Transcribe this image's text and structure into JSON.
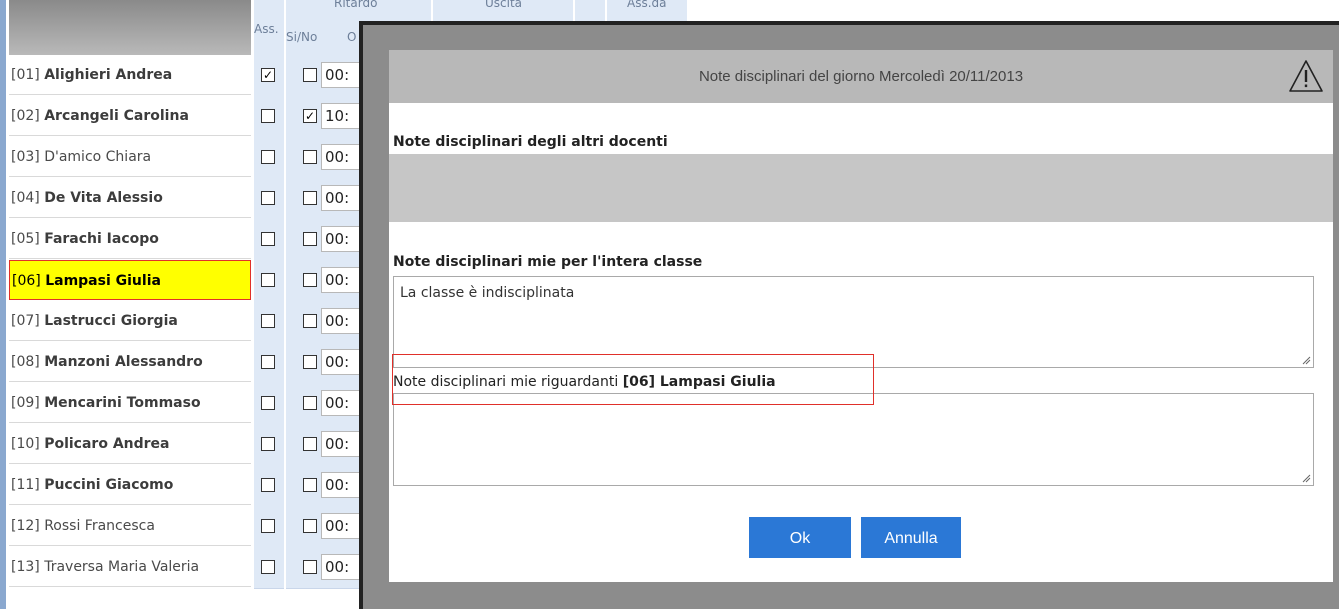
{
  "register": {
    "col_ass": "Ass.",
    "col_ritardo": "Ritardo",
    "col_sino": "Si/No",
    "col_ritardo_o": "O",
    "col_uscita": "Uscita",
    "col_ass_da": "Ass.da",
    "students": [
      {
        "num": "[01]",
        "name": "Alighieri Andrea",
        "bold": true,
        "ass": "☑",
        "rit": "☐",
        "time": "00:"
      },
      {
        "num": "[02]",
        "name": "Arcangeli Carolina",
        "bold": true,
        "ass": "☐",
        "rit": "☑",
        "time": "10:"
      },
      {
        "num": "[03]",
        "name": "D'amico Chiara",
        "bold": false,
        "ass": "☐",
        "rit": "☐",
        "time": "00:"
      },
      {
        "num": "[04]",
        "name": "De Vita Alessio",
        "bold": true,
        "ass": "☐",
        "rit": "☐",
        "time": "00:"
      },
      {
        "num": "[05]",
        "name": "Farachi Iacopo",
        "bold": true,
        "ass": "☐",
        "rit": "☐",
        "time": "00:"
      },
      {
        "num": "[06]",
        "name": "Lampasi Giulia",
        "bold": true,
        "ass": "☐",
        "rit": "☐",
        "time": "00:"
      },
      {
        "num": "[07]",
        "name": "Lastrucci Giorgia",
        "bold": true,
        "ass": "☐",
        "rit": "☐",
        "time": "00:"
      },
      {
        "num": "[08]",
        "name": "Manzoni Alessandro",
        "bold": true,
        "ass": "☐",
        "rit": "☐",
        "time": "00:"
      },
      {
        "num": "[09]",
        "name": "Mencarini Tommaso",
        "bold": true,
        "ass": "☐",
        "rit": "☐",
        "time": "00:"
      },
      {
        "num": "[10]",
        "name": "Policaro Andrea",
        "bold": true,
        "ass": "☐",
        "rit": "☐",
        "time": "00:"
      },
      {
        "num": "[11]",
        "name": "Puccini Giacomo",
        "bold": true,
        "ass": "☐",
        "rit": "☐",
        "time": "00:"
      },
      {
        "num": "[12]",
        "name": "Rossi Francesca",
        "bold": false,
        "ass": "☐",
        "rit": "☐",
        "time": "00:"
      },
      {
        "num": "[13]",
        "name": "Traversa Maria Valeria",
        "bold": false,
        "ass": "☐",
        "rit": "☐",
        "time": "00:"
      }
    ],
    "selected_index": 5
  },
  "dialog": {
    "title": "Note disciplinari del giorno  Mercoledì 20/11/2013",
    "warning_icon": "warning-triangle-icon",
    "others_label": "Note disciplinari degli altri docenti",
    "class_label": "Note disciplinari mie per l'intera classe",
    "class_value": "La classe è indisciplinata",
    "student_label_prefix": "Note disciplinari mie riguardanti ",
    "student_label_name": "[06] Lampasi Giulia",
    "student_value": "",
    "ok_label": "Ok",
    "cancel_label": "Annulla"
  },
  "colors": {
    "selection": "#ffff00",
    "highlight_border": "#e0302a",
    "button": "#2b78d6",
    "dialog_overlay": "#8c8c8c",
    "titlebar": "#b8b8b8"
  }
}
